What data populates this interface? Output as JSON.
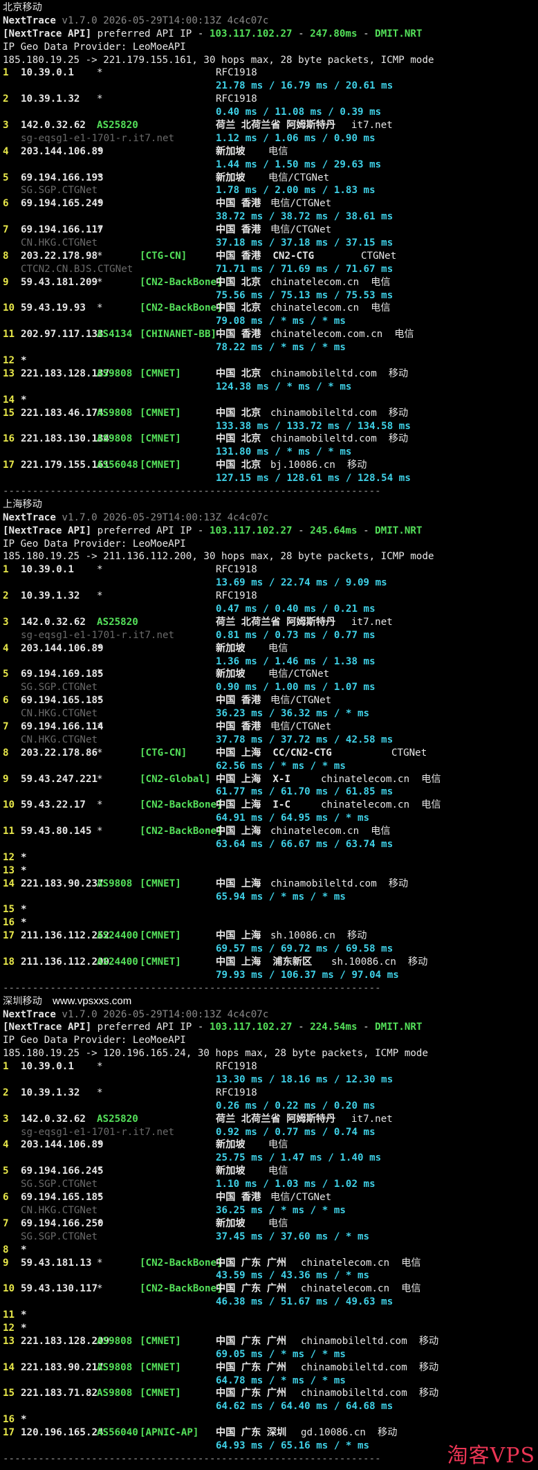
{
  "watermark": "淘客VPS",
  "sections": [
    {
      "title": "北京移动",
      "site": "",
      "version_label": "NextTrace",
      "version": "v1.7.0 2026-05-29T14:00:13Z 4c4c07c",
      "api_prefix": "[NextTrace API]",
      "api_mid": " preferred API IP - ",
      "api_ip": "103.117.102.27",
      "api_dash": " - ",
      "api_latency": "247.80ms",
      "api_dash2": " - ",
      "api_pop": "DMIT.NRT",
      "geo_provider": "IP Geo Data Provider: LeoMoeAPI",
      "trace_info": "185.180.19.25 -> 221.179.155.161, 30 hops max, 28 byte packets, ICMP mode",
      "hops": [
        {
          "n": "1",
          "ip": "10.39.0.1",
          "asn": "*",
          "tag": "",
          "geo": "RFC1918",
          "rdns": "",
          "rtt": "21.78 ms / 16.79 ms / 20.61 ms"
        },
        {
          "n": "2",
          "ip": "10.39.1.32",
          "asn": "*",
          "tag": "",
          "geo": "RFC1918",
          "rdns": "",
          "rtt": "0.40 ms / 11.08 ms / 0.39 ms"
        },
        {
          "n": "3",
          "ip": "142.0.32.62",
          "asn": "AS25820",
          "tag": "",
          "geo": "荷兰 北荷兰省 阿姆斯特丹",
          "site": "it7.net",
          "rdns": "sg-eqsg1-e1-1701-r.it7.net",
          "rtt": "1.12 ms / 1.06 ms / 0.90 ms"
        },
        {
          "n": "4",
          "ip": "203.144.106.89",
          "asn": "*",
          "tag": "",
          "geo": "新加坡",
          "site": "电信",
          "rdns": "",
          "rtt": "1.44 ms / 1.50 ms / 29.63 ms"
        },
        {
          "n": "5",
          "ip": "69.194.166.193",
          "asn": "*",
          "tag": "",
          "geo": "新加坡",
          "site": "电信/CTGNet",
          "rdns": "SG.SGP.CTGNet",
          "rtt": "1.78 ms / 2.00 ms / 1.83 ms"
        },
        {
          "n": "6",
          "ip": "69.194.165.249",
          "asn": "*",
          "tag": "",
          "geo": "中国 香港",
          "site": "电信/CTGNet",
          "rdns": "",
          "rtt": "38.72 ms / 38.72 ms / 38.61 ms"
        },
        {
          "n": "7",
          "ip": "69.194.166.117",
          "asn": "*",
          "tag": "",
          "geo": "中国 香港",
          "site": "电信/CTGNet",
          "rdns": "CN.HKG.CTGNet",
          "rtt": "37.18 ms / 37.18 ms / 37.15 ms"
        },
        {
          "n": "8",
          "ip": "203.22.178.98",
          "asn": "*",
          "tag": "[CTG-CN]",
          "geo": "中国 香港  CN2-CTG",
          "site": "CTGNet",
          "rdns": "CTCN2.CN.BJS.CTGNet",
          "rtt": "71.71 ms / 71.69 ms / 71.67 ms"
        },
        {
          "n": "9",
          "ip": "59.43.181.209",
          "asn": "*",
          "tag": "[CN2-BackBone]",
          "geo": "中国 北京",
          "site": "chinatelecom.cn  电信",
          "rdns": "",
          "rtt": "75.56 ms / 75.13 ms / 75.53 ms"
        },
        {
          "n": "10",
          "ip": "59.43.19.93",
          "asn": "*",
          "tag": "[CN2-BackBone]",
          "geo": "中国 北京",
          "site": "chinatelecom.cn  电信",
          "rdns": "",
          "rtt": "79.08 ms / * ms / * ms"
        },
        {
          "n": "11",
          "ip": "202.97.117.133",
          "asn": "AS4134",
          "tag": "[CHINANET-BB]",
          "geo": "中国 香港",
          "site": "chinatelecom.com.cn  电信",
          "rdns": "",
          "rtt": "78.22 ms / * ms / * ms"
        },
        {
          "n": "12",
          "ip": "*",
          "asn": "",
          "tag": "",
          "geo": "",
          "rdns": "",
          "rtt": ""
        },
        {
          "n": "13",
          "ip": "221.183.128.137",
          "asn": "AS9808",
          "tag": "[CMNET]",
          "geo": "中国 北京",
          "site": "chinamobileltd.com  移动",
          "rdns": "",
          "rtt": "124.38 ms / * ms / * ms"
        },
        {
          "n": "14",
          "ip": "*",
          "asn": "",
          "tag": "",
          "geo": "",
          "rdns": "",
          "rtt": ""
        },
        {
          "n": "15",
          "ip": "221.183.46.174",
          "asn": "AS9808",
          "tag": "[CMNET]",
          "geo": "中国 北京",
          "site": "chinamobileltd.com  移动",
          "rdns": "",
          "rtt": "133.38 ms / 133.72 ms / 134.58 ms"
        },
        {
          "n": "16",
          "ip": "221.183.130.134",
          "asn": "AS9808",
          "tag": "[CMNET]",
          "geo": "中国 北京",
          "site": "chinamobileltd.com  移动",
          "rdns": "",
          "rtt": "131.80 ms / * ms / * ms"
        },
        {
          "n": "17",
          "ip": "221.179.155.161",
          "asn": "AS56048",
          "tag": "[CMNET]",
          "geo": "中国 北京",
          "site": "bj.10086.cn  移动",
          "rdns": "",
          "rtt": "127.15 ms / 128.61 ms / 128.54 ms"
        }
      ]
    },
    {
      "title": "上海移动",
      "site": "",
      "version_label": "NextTrace",
      "version": "v1.7.0 2026-05-29T14:00:13Z 4c4c07c",
      "api_prefix": "[NextTrace API]",
      "api_mid": " preferred API IP - ",
      "api_ip": "103.117.102.27",
      "api_dash": " - ",
      "api_latency": "245.64ms",
      "api_dash2": " - ",
      "api_pop": "DMIT.NRT",
      "geo_provider": "IP Geo Data Provider: LeoMoeAPI",
      "trace_info": "185.180.19.25 -> 211.136.112.200, 30 hops max, 28 byte packets, ICMP mode",
      "hops": [
        {
          "n": "1",
          "ip": "10.39.0.1",
          "asn": "*",
          "tag": "",
          "geo": "RFC1918",
          "rdns": "",
          "rtt": "13.69 ms / 22.74 ms / 9.09 ms"
        },
        {
          "n": "2",
          "ip": "10.39.1.32",
          "asn": "*",
          "tag": "",
          "geo": "RFC1918",
          "rdns": "",
          "rtt": "0.47 ms / 0.40 ms / 0.21 ms"
        },
        {
          "n": "3",
          "ip": "142.0.32.62",
          "asn": "AS25820",
          "tag": "",
          "geo": "荷兰 北荷兰省 阿姆斯特丹",
          "site": "it7.net",
          "rdns": "sg-eqsg1-e1-1701-r.it7.net",
          "rtt": "0.81 ms / 0.73 ms / 0.77 ms"
        },
        {
          "n": "4",
          "ip": "203.144.106.89",
          "asn": "*",
          "tag": "",
          "geo": "新加坡",
          "site": "电信",
          "rdns": "",
          "rtt": "1.36 ms / 1.46 ms / 1.38 ms"
        },
        {
          "n": "5",
          "ip": "69.194.169.185",
          "asn": "*",
          "tag": "",
          "geo": "新加坡",
          "site": "电信/CTGNet",
          "rdns": "SG.SGP.CTGNet",
          "rtt": "0.90 ms / 1.00 ms / 1.07 ms"
        },
        {
          "n": "6",
          "ip": "69.194.165.185",
          "asn": "*",
          "tag": "",
          "geo": "中国 香港",
          "site": "电信/CTGNet",
          "rdns": "CN.HKG.CTGNet",
          "rtt": "36.23 ms / 36.32 ms / * ms"
        },
        {
          "n": "7",
          "ip": "69.194.166.114",
          "asn": "*",
          "tag": "",
          "geo": "中国 香港",
          "site": "电信/CTGNet",
          "rdns": "CN.HKG.CTGNet",
          "rtt": "37.78 ms / 37.72 ms / 42.58 ms"
        },
        {
          "n": "8",
          "ip": "203.22.178.86",
          "asn": "*",
          "tag": "[CTG-CN]",
          "geo": "中国 上海  CC/CN2-CTG",
          "site": "CTGNet",
          "rdns": "",
          "rtt": "62.56 ms / * ms / * ms"
        },
        {
          "n": "9",
          "ip": "59.43.247.221",
          "asn": "*",
          "tag": "[CN2-Global]",
          "geo": "中国 上海  X-I",
          "site": "chinatelecom.cn  电信",
          "rdns": "",
          "rtt": "61.77 ms / 61.70 ms / 61.85 ms"
        },
        {
          "n": "10",
          "ip": "59.43.22.17",
          "asn": "*",
          "tag": "[CN2-BackBone]",
          "geo": "中国 上海  I-C",
          "site": "chinatelecom.cn  电信",
          "rdns": "",
          "rtt": "64.91 ms / 64.95 ms / * ms"
        },
        {
          "n": "11",
          "ip": "59.43.80.145",
          "asn": "*",
          "tag": "[CN2-BackBone]",
          "geo": "中国 上海",
          "site": "chinatelecom.cn  电信",
          "rdns": "",
          "rtt": "63.64 ms / 66.67 ms / 63.74 ms"
        },
        {
          "n": "12",
          "ip": "*",
          "asn": "",
          "tag": "",
          "geo": "",
          "rdns": "",
          "rtt": ""
        },
        {
          "n": "13",
          "ip": "*",
          "asn": "",
          "tag": "",
          "geo": "",
          "rdns": "",
          "rtt": ""
        },
        {
          "n": "14",
          "ip": "221.183.90.237",
          "asn": "AS9808",
          "tag": "[CMNET]",
          "geo": "中国 上海",
          "site": "chinamobileltd.com  移动",
          "rdns": "",
          "rtt": "65.94 ms / * ms / * ms"
        },
        {
          "n": "15",
          "ip": "*",
          "asn": "",
          "tag": "",
          "geo": "",
          "rdns": "",
          "rtt": ""
        },
        {
          "n": "16",
          "ip": "*",
          "asn": "",
          "tag": "",
          "geo": "",
          "rdns": "",
          "rtt": ""
        },
        {
          "n": "17",
          "ip": "211.136.112.252",
          "asn": "AS24400",
          "tag": "[CMNET]",
          "geo": "中国 上海",
          "site": "sh.10086.cn  移动",
          "rdns": "",
          "rtt": "69.57 ms / 69.72 ms / 69.58 ms"
        },
        {
          "n": "18",
          "ip": "211.136.112.200",
          "asn": "AS24400",
          "tag": "[CMNET]",
          "geo": "中国 上海  浦东新区",
          "site": "sh.10086.cn  移动",
          "rdns": "",
          "rtt": "79.93 ms / 106.37 ms / 97.04 ms"
        }
      ]
    },
    {
      "title": "深圳移动",
      "site": "www.vpsxxs.com",
      "version_label": "NextTrace",
      "version": "v1.7.0 2026-05-29T14:00:13Z 4c4c07c",
      "api_prefix": "[NextTrace API]",
      "api_mid": " preferred API IP - ",
      "api_ip": "103.117.102.27",
      "api_dash": " - ",
      "api_latency": "224.54ms",
      "api_dash2": " - ",
      "api_pop": "DMIT.NRT",
      "geo_provider": "IP Geo Data Provider: LeoMoeAPI",
      "trace_info": "185.180.19.25 -> 120.196.165.24, 30 hops max, 28 byte packets, ICMP mode",
      "hops": [
        {
          "n": "1",
          "ip": "10.39.0.1",
          "asn": "*",
          "tag": "",
          "geo": "RFC1918",
          "rdns": "",
          "rtt": "13.30 ms / 18.16 ms / 12.30 ms"
        },
        {
          "n": "2",
          "ip": "10.39.1.32",
          "asn": "*",
          "tag": "",
          "geo": "RFC1918",
          "rdns": "",
          "rtt": "0.26 ms / 0.22 ms / 0.20 ms"
        },
        {
          "n": "3",
          "ip": "142.0.32.62",
          "asn": "AS25820",
          "tag": "",
          "geo": "荷兰 北荷兰省 阿姆斯特丹",
          "site": "it7.net",
          "rdns": "sg-eqsg1-e1-1701-r.it7.net",
          "rtt": "0.92 ms / 0.77 ms / 0.74 ms"
        },
        {
          "n": "4",
          "ip": "203.144.106.89",
          "asn": "*",
          "tag": "",
          "geo": "新加坡",
          "site": "电信",
          "rdns": "",
          "rtt": "25.75 ms / 1.47 ms / 1.40 ms"
        },
        {
          "n": "5",
          "ip": "69.194.166.245",
          "asn": "*",
          "tag": "",
          "geo": "新加坡",
          "site": "电信",
          "rdns": "SG.SGP.CTGNet",
          "rtt": "1.10 ms / 1.03 ms / 1.02 ms"
        },
        {
          "n": "6",
          "ip": "69.194.165.185",
          "asn": "*",
          "tag": "",
          "geo": "中国 香港",
          "site": "电信/CTGNet",
          "rdns": "CN.HKG.CTGNet",
          "rtt": "36.25 ms / * ms / * ms"
        },
        {
          "n": "7",
          "ip": "69.194.166.250",
          "asn": "*",
          "tag": "",
          "geo": "新加坡",
          "site": "电信",
          "rdns": "SG.SGP.CTGNet",
          "rtt": "37.45 ms / 37.60 ms / * ms"
        },
        {
          "n": "8",
          "ip": "*",
          "asn": "",
          "tag": "",
          "geo": "",
          "rdns": "",
          "rtt": ""
        },
        {
          "n": "9",
          "ip": "59.43.181.13",
          "asn": "*",
          "tag": "[CN2-BackBone]",
          "geo": "中国 广东 广州",
          "site": "chinatelecom.cn  电信",
          "rdns": "",
          "rtt": "43.59 ms / 43.36 ms / * ms"
        },
        {
          "n": "10",
          "ip": "59.43.130.117",
          "asn": "*",
          "tag": "[CN2-BackBone]",
          "geo": "中国 广东 广州",
          "site": "chinatelecom.cn  电信",
          "rdns": "",
          "rtt": "46.38 ms / 51.67 ms / 49.63 ms"
        },
        {
          "n": "11",
          "ip": "*",
          "asn": "",
          "tag": "",
          "geo": "",
          "rdns": "",
          "rtt": ""
        },
        {
          "n": "12",
          "ip": "*",
          "asn": "",
          "tag": "",
          "geo": "",
          "rdns": "",
          "rtt": ""
        },
        {
          "n": "13",
          "ip": "221.183.128.209",
          "asn": "AS9808",
          "tag": "[CMNET]",
          "geo": "中国 广东 广州",
          "site": "chinamobileltd.com  移动",
          "rdns": "",
          "rtt": "69.05 ms / * ms / * ms"
        },
        {
          "n": "14",
          "ip": "221.183.90.217",
          "asn": "AS9808",
          "tag": "[CMNET]",
          "geo": "中国 广东 广州",
          "site": "chinamobileltd.com  移动",
          "rdns": "",
          "rtt": "64.78 ms / * ms / * ms"
        },
        {
          "n": "15",
          "ip": "221.183.71.82",
          "asn": "AS9808",
          "tag": "[CMNET]",
          "geo": "中国 广东 广州",
          "site": "chinamobileltd.com  移动",
          "rdns": "",
          "rtt": "64.62 ms / 64.40 ms / 64.68 ms"
        },
        {
          "n": "16",
          "ip": "*",
          "asn": "",
          "tag": "",
          "geo": "",
          "rdns": "",
          "rtt": ""
        },
        {
          "n": "17",
          "ip": "120.196.165.24",
          "asn": "AS56040",
          "tag": "[APNIC-AP]",
          "geo": "中国 广东 深圳",
          "site": "gd.10086.cn  移动",
          "rdns": "",
          "rtt": "64.93 ms / 65.16 ms / * ms"
        }
      ]
    }
  ]
}
